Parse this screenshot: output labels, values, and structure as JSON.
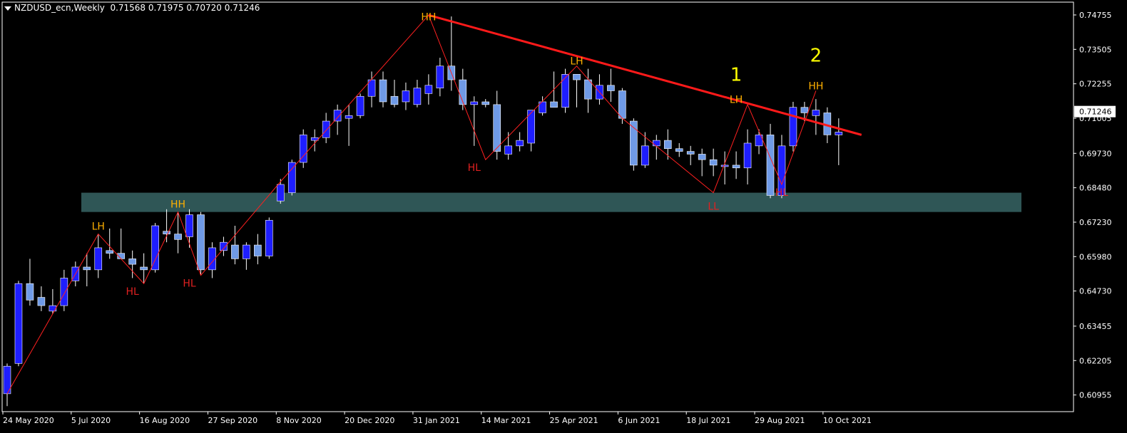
{
  "header": {
    "symbol": "NZDUSD_ecn,Weekly",
    "ohlc": "0.71568 0.71975 0.70720 0.71246"
  },
  "colors": {
    "background": "#000000",
    "bull": "#1e1eff",
    "bear": "#6f9ae6",
    "zigzag": "#ff2020",
    "trendline": "#ff1a1a",
    "zone": "#2f5656",
    "high_label": "#ffb000",
    "low_label": "#e02020",
    "count_label": "#ffff00",
    "axis": "#ffffff"
  },
  "chart_data": {
    "type": "candlestick",
    "title": "NZDUSD_ecn,Weekly",
    "ylim": [
      0.6035,
      0.7522
    ],
    "y_ticks": [
      "0.74755",
      "0.73505",
      "0.72255",
      "0.71005",
      "0.69730",
      "0.68480",
      "0.67230",
      "0.65980",
      "0.64730",
      "0.63455",
      "0.62205",
      "0.60955"
    ],
    "x_tick_labels": [
      {
        "label": "24 May 2020",
        "index": 0
      },
      {
        "label": "5 Jul 2020",
        "index": 6
      },
      {
        "label": "16 Aug 2020",
        "index": 12
      },
      {
        "label": "27 Sep 2020",
        "index": 18
      },
      {
        "label": "8 Nov 2020",
        "index": 24
      },
      {
        "label": "20 Dec 2020",
        "index": 30
      },
      {
        "label": "31 Jan 2021",
        "index": 36
      },
      {
        "label": "14 Mar 2021",
        "index": 42
      },
      {
        "label": "25 Apr 2021",
        "index": 48
      },
      {
        "label": "6 Jun 2021",
        "index": 54
      },
      {
        "label": "18 Jul 2021",
        "index": 60
      },
      {
        "label": "29 Aug 2021",
        "index": 66
      },
      {
        "label": "10 Oct 2021",
        "index": 72
      }
    ],
    "current_price": "0.71246",
    "candles": [
      [
        0.61,
        0.621,
        0.6055,
        0.62
      ],
      [
        0.621,
        0.651,
        0.62,
        0.65
      ],
      [
        0.65,
        0.659,
        0.642,
        0.644
      ],
      [
        0.645,
        0.649,
        0.64,
        0.642
      ],
      [
        0.64,
        0.648,
        0.639,
        0.642
      ],
      [
        0.642,
        0.655,
        0.64,
        0.652
      ],
      [
        0.651,
        0.658,
        0.649,
        0.656
      ],
      [
        0.656,
        0.661,
        0.649,
        0.655
      ],
      [
        0.655,
        0.668,
        0.652,
        0.663
      ],
      [
        0.662,
        0.67,
        0.659,
        0.661
      ],
      [
        0.661,
        0.67,
        0.659,
        0.659
      ],
      [
        0.659,
        0.662,
        0.652,
        0.657
      ],
      [
        0.656,
        0.661,
        0.65,
        0.655
      ],
      [
        0.655,
        0.672,
        0.654,
        0.671
      ],
      [
        0.669,
        0.677,
        0.665,
        0.668
      ],
      [
        0.668,
        0.676,
        0.661,
        0.666
      ],
      [
        0.667,
        0.677,
        0.663,
        0.675
      ],
      [
        0.675,
        0.676,
        0.653,
        0.655
      ],
      [
        0.655,
        0.665,
        0.652,
        0.663
      ],
      [
        0.662,
        0.667,
        0.66,
        0.665
      ],
      [
        0.664,
        0.671,
        0.657,
        0.659
      ],
      [
        0.659,
        0.665,
        0.655,
        0.664
      ],
      [
        0.664,
        0.668,
        0.657,
        0.66
      ],
      [
        0.66,
        0.674,
        0.659,
        0.673
      ],
      [
        0.68,
        0.688,
        0.679,
        0.686
      ],
      [
        0.683,
        0.695,
        0.682,
        0.694
      ],
      [
        0.694,
        0.706,
        0.692,
        0.704
      ],
      [
        0.702,
        0.706,
        0.698,
        0.703
      ],
      [
        0.703,
        0.712,
        0.701,
        0.709
      ],
      [
        0.709,
        0.715,
        0.704,
        0.713
      ],
      [
        0.71,
        0.715,
        0.7,
        0.711
      ],
      [
        0.711,
        0.719,
        0.71,
        0.718
      ],
      [
        0.718,
        0.727,
        0.714,
        0.724
      ],
      [
        0.724,
        0.727,
        0.714,
        0.716
      ],
      [
        0.718,
        0.724,
        0.714,
        0.715
      ],
      [
        0.716,
        0.723,
        0.713,
        0.72
      ],
      [
        0.715,
        0.724,
        0.714,
        0.721
      ],
      [
        0.719,
        0.726,
        0.715,
        0.722
      ],
      [
        0.721,
        0.732,
        0.718,
        0.729
      ],
      [
        0.729,
        0.747,
        0.72,
        0.724
      ],
      [
        0.724,
        0.728,
        0.713,
        0.715
      ],
      [
        0.715,
        0.718,
        0.7,
        0.716
      ],
      [
        0.716,
        0.717,
        0.714,
        0.715
      ],
      [
        0.715,
        0.72,
        0.695,
        0.698
      ],
      [
        0.697,
        0.705,
        0.695,
        0.7
      ],
      [
        0.7,
        0.705,
        0.698,
        0.702
      ],
      [
        0.701,
        0.71,
        0.698,
        0.713
      ],
      [
        0.712,
        0.718,
        0.711,
        0.716
      ],
      [
        0.716,
        0.727,
        0.714,
        0.714
      ],
      [
        0.714,
        0.728,
        0.712,
        0.726
      ],
      [
        0.726,
        0.726,
        0.714,
        0.724
      ],
      [
        0.724,
        0.728,
        0.712,
        0.717
      ],
      [
        0.717,
        0.726,
        0.715,
        0.722
      ],
      [
        0.722,
        0.728,
        0.716,
        0.72
      ],
      [
        0.72,
        0.721,
        0.708,
        0.71
      ],
      [
        0.709,
        0.71,
        0.691,
        0.693
      ],
      [
        0.693,
        0.705,
        0.692,
        0.7
      ],
      [
        0.7,
        0.704,
        0.695,
        0.702
      ],
      [
        0.702,
        0.706,
        0.695,
        0.699
      ],
      [
        0.699,
        0.701,
        0.696,
        0.698
      ],
      [
        0.698,
        0.7,
        0.693,
        0.697
      ],
      [
        0.697,
        0.699,
        0.689,
        0.695
      ],
      [
        0.695,
        0.699,
        0.689,
        0.693
      ],
      [
        0.693,
        0.698,
        0.686,
        0.693
      ],
      [
        0.693,
        0.698,
        0.688,
        0.692
      ],
      [
        0.692,
        0.706,
        0.686,
        0.701
      ],
      [
        0.7,
        0.706,
        0.697,
        0.704
      ],
      [
        0.704,
        0.708,
        0.681,
        0.682
      ],
      [
        0.682,
        0.704,
        0.681,
        0.7
      ],
      [
        0.7,
        0.716,
        0.698,
        0.714
      ],
      [
        0.714,
        0.716,
        0.709,
        0.712
      ],
      [
        0.711,
        0.717,
        0.704,
        0.713
      ],
      [
        0.712,
        0.714,
        0.701,
        0.704
      ],
      [
        0.704,
        0.71,
        0.693,
        0.705
      ]
    ],
    "zone": {
      "top": 0.683,
      "bottom": 0.676
    },
    "trendline": [
      [
        37,
        0.7475
      ],
      [
        75,
        0.704
      ]
    ],
    "zigzag": [
      [
        0,
        0.61
      ],
      [
        8,
        0.668
      ],
      [
        12,
        0.65
      ],
      [
        15,
        0.676
      ],
      [
        17,
        0.653
      ],
      [
        24,
        0.687
      ],
      [
        37,
        0.7475
      ],
      [
        42,
        0.695
      ],
      [
        50,
        0.729
      ],
      [
        54,
        0.71
      ],
      [
        62,
        0.683
      ],
      [
        65,
        0.715
      ],
      [
        68,
        0.686
      ],
      [
        71,
        0.72
      ]
    ],
    "swing_labels": [
      {
        "text": "LH",
        "x": 8,
        "y": 0.668,
        "pos": "above",
        "kind": "high"
      },
      {
        "text": "HL",
        "x": 11,
        "y": 0.65,
        "pos": "below",
        "kind": "low"
      },
      {
        "text": "HH",
        "x": 15,
        "y": 0.676,
        "pos": "above",
        "kind": "high"
      },
      {
        "text": "HL",
        "x": 16,
        "y": 0.653,
        "pos": "below",
        "kind": "low"
      },
      {
        "text": "HH",
        "x": 37,
        "y": 0.744,
        "pos": "above",
        "kind": "high"
      },
      {
        "text": "HL",
        "x": 41,
        "y": 0.695,
        "pos": "below",
        "kind": "low"
      },
      {
        "text": "LH",
        "x": 50,
        "y": 0.728,
        "pos": "above",
        "kind": "high"
      },
      {
        "text": "LL",
        "x": 62,
        "y": 0.681,
        "pos": "below",
        "kind": "low"
      },
      {
        "text": "LH",
        "x": 64,
        "y": 0.714,
        "pos": "above",
        "kind": "high"
      },
      {
        "text": "HL",
        "x": 68,
        "y": 0.686,
        "pos": "below",
        "kind": "low"
      },
      {
        "text": "HH",
        "x": 71,
        "y": 0.719,
        "pos": "above",
        "kind": "high"
      }
    ],
    "count_labels": [
      {
        "text": "1",
        "x": 64,
        "y": 0.721
      },
      {
        "text": "2",
        "x": 71,
        "y": 0.728
      }
    ]
  }
}
